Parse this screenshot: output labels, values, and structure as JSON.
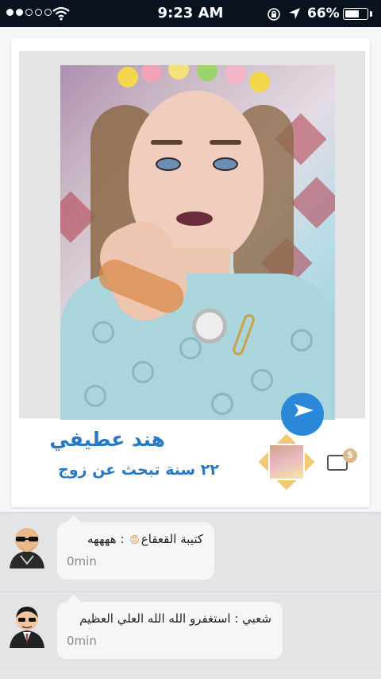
{
  "status_bar": {
    "time": "9:23 AM",
    "battery_percent": "66%",
    "battery_level": 0.66,
    "signal_dots_filled": 2,
    "signal_dots_total": 5,
    "icons": [
      "wifi-icon",
      "rotation-lock-icon",
      "location-arrow-icon",
      "battery-icon"
    ]
  },
  "post": {
    "user_name": "هند عطيفي",
    "description": "٢٢ سنة تبحث عن زوج",
    "gift_count": "5",
    "icons": [
      "share-icon",
      "gift-icon"
    ],
    "colors": {
      "accent": "#2878c4",
      "share_button": "#2b88d8"
    }
  },
  "comments": [
    {
      "author": "كتيبة القعقاع",
      "text": "ههههه",
      "time": "0min"
    },
    {
      "author": "شعبي",
      "text": "استغفرو الله الله العلي العظيم",
      "time": "0min"
    }
  ]
}
